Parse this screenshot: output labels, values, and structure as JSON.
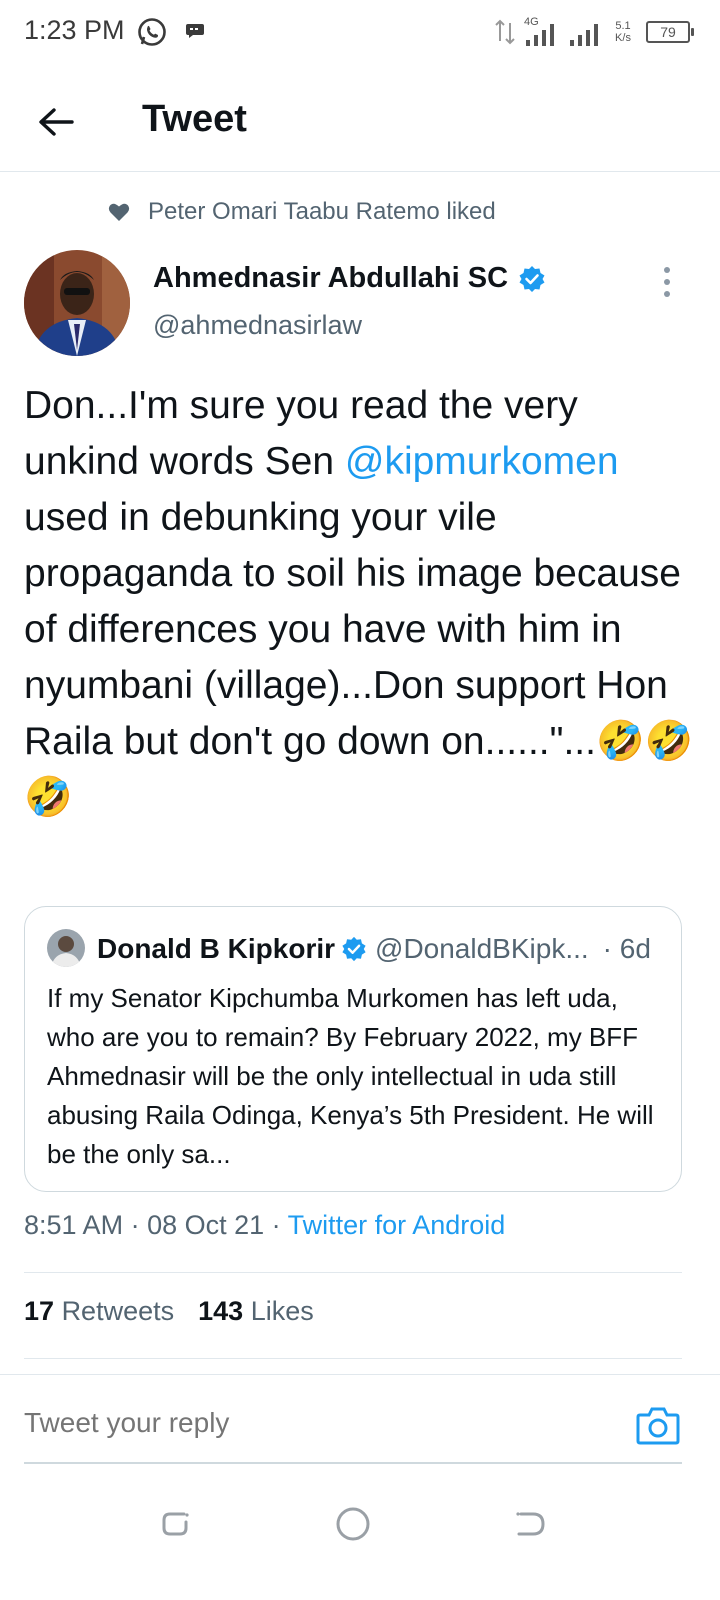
{
  "status_bar": {
    "time": "1:23 PM",
    "network_type": "4G",
    "speed_value": "5.1",
    "speed_unit": "K/s",
    "battery": "79"
  },
  "header": {
    "title": "Tweet"
  },
  "social_context": {
    "text": "Peter Omari Taabu Ratemo liked"
  },
  "tweet": {
    "author_name": "Ahmednasir Abdullahi SC",
    "author_handle": "@ahmednasirlaw",
    "text_before_mention": "Don...I'm sure you read the very unkind words Sen ",
    "mention": "@kipmurkomen",
    "text_after_mention": " used in debunking your vile propaganda to soil his image because of differences you have with him in nyumbani (village)...Don support Hon Raila but don't go down on......\"...🤣🤣🤣",
    "time": "8:51 AM",
    "date": "08 Oct 21",
    "source": "Twitter for Android",
    "separator": " · "
  },
  "quoted_tweet": {
    "author_name": "Donald B Kipkorir",
    "author_handle": "@DonaldBKipk...",
    "time": "· 6d",
    "text": "If my Senator Kipchumba Murkomen has left uda, who are you to remain?  By February 2022, my BFF Ahmednasir will be the only intellectual in uda still abusing Raila Odinga, Kenya’s 5th President. He will be the only sa..."
  },
  "stats": {
    "retweets_count": "17",
    "retweets_label": "Retweets",
    "likes_count": "143",
    "likes_label": "Likes"
  },
  "reply": {
    "placeholder": "Tweet your reply"
  },
  "colors": {
    "accent": "#1d9bf0",
    "text_primary": "#0f1419",
    "text_secondary": "#536471"
  }
}
